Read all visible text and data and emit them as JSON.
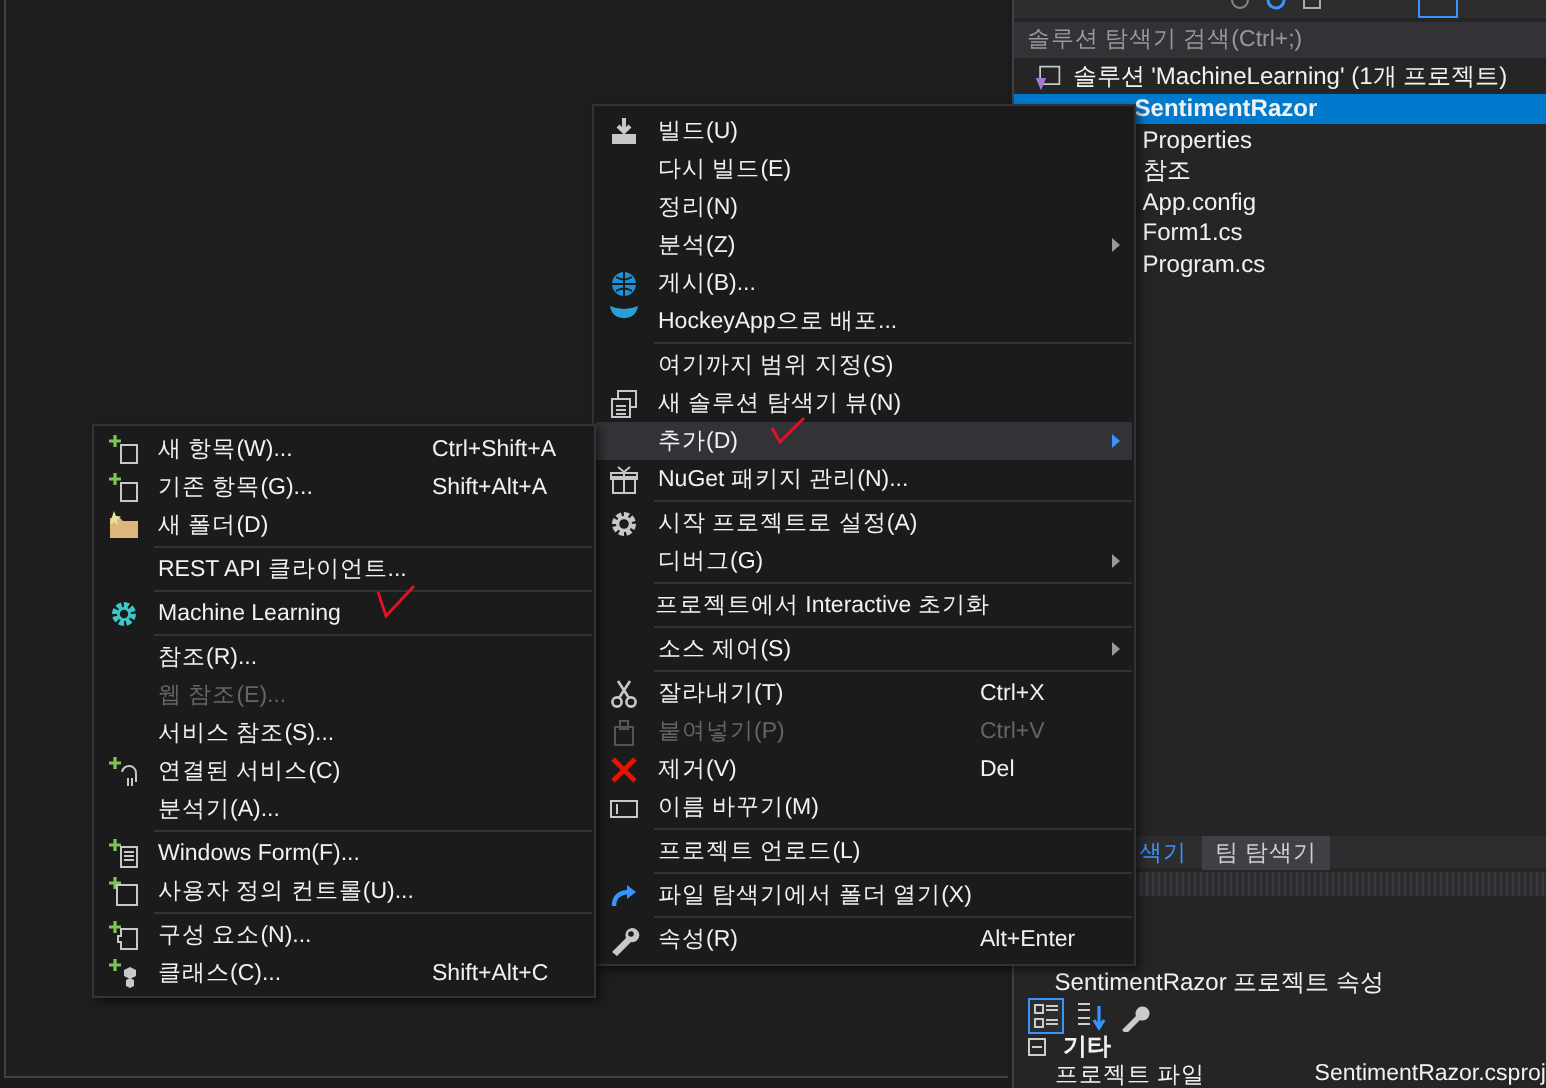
{
  "solution_explorer": {
    "search": {
      "placeholder": "솔루션 탐색기 검색(Ctrl+;)"
    },
    "tree": [
      {
        "label": "솔루션 'MachineLearning' (1개 프로젝트)",
        "selected": false,
        "startup": false,
        "children": [
          {
            "label": "SentimentRazor",
            "selected": true,
            "startup": true,
            "children": [
              {
                "label": "Properties",
                "selected": false,
                "startup": false
              },
              {
                "label": "참조",
                "selected": false,
                "startup": false
              },
              {
                "label": "App.config",
                "selected": false,
                "startup": false
              },
              {
                "label": "Form1.cs",
                "selected": false,
                "startup": false
              },
              {
                "label": "Program.cs",
                "selected": false,
                "startup": false
              }
            ]
          }
        ]
      }
    ]
  },
  "tabs": [
    {
      "label": "색기",
      "selected": true
    },
    {
      "label": "팀 탐색기",
      "selected": false
    }
  ],
  "properties": {
    "title": "SentimentRazor 프로젝트 속성",
    "category": {
      "label": "기타",
      "expanded": true
    },
    "rows": [
      {
        "name": "프로젝트 파일",
        "value": "SentimentRazor.csproj"
      }
    ]
  },
  "context_menu": {
    "items": [
      {
        "kind": "item",
        "label": "빌드(U)",
        "selected": false,
        "disabled": false,
        "submenu": false
      },
      {
        "kind": "item",
        "label": "다시 빌드(E)",
        "selected": false,
        "disabled": false,
        "submenu": false
      },
      {
        "kind": "item",
        "label": "정리(N)",
        "selected": false,
        "disabled": false,
        "submenu": false
      },
      {
        "kind": "item",
        "label": "분석(Z)",
        "selected": false,
        "disabled": false,
        "submenu": true
      },
      {
        "kind": "item",
        "label": "게시(B)...",
        "selected": false,
        "disabled": false,
        "submenu": false
      },
      {
        "kind": "item",
        "label": "HockeyApp으로 배포...",
        "selected": false,
        "disabled": false,
        "submenu": false
      },
      {
        "kind": "separator"
      },
      {
        "kind": "item",
        "label": "여기까지 범위 지정(S)",
        "selected": false,
        "disabled": false,
        "submenu": false
      },
      {
        "kind": "item",
        "label": "새 솔루션 탐색기 뷰(N)",
        "selected": false,
        "disabled": false,
        "submenu": false
      },
      {
        "kind": "item",
        "label": "추가(D)",
        "selected": true,
        "disabled": false,
        "submenu": true
      },
      {
        "kind": "item",
        "label": "NuGet 패키지 관리(N)...",
        "selected": false,
        "disabled": false,
        "submenu": false
      },
      {
        "kind": "separator"
      },
      {
        "kind": "item",
        "label": "시작 프로젝트로 설정(A)",
        "selected": false,
        "disabled": false,
        "submenu": false
      },
      {
        "kind": "item",
        "label": "디버그(G)",
        "selected": false,
        "disabled": false,
        "submenu": true
      },
      {
        "kind": "separator"
      },
      {
        "kind": "item",
        "label": "프로젝트에서 Interactive 초기화",
        "selected": false,
        "disabled": false,
        "submenu": false
      },
      {
        "kind": "separator"
      },
      {
        "kind": "item",
        "label": "소스 제어(S)",
        "selected": false,
        "disabled": false,
        "submenu": true
      },
      {
        "kind": "separator"
      },
      {
        "kind": "item",
        "label": "잘라내기(T)",
        "shortcut": "Ctrl+X",
        "selected": false,
        "disabled": false,
        "submenu": false
      },
      {
        "kind": "item",
        "label": "붙여넣기(P)",
        "shortcut": "Ctrl+V",
        "selected": false,
        "disabled": true,
        "submenu": false
      },
      {
        "kind": "item",
        "label": "제거(V)",
        "shortcut": "Del",
        "selected": false,
        "disabled": false,
        "submenu": false
      },
      {
        "kind": "item",
        "label": "이름 바꾸기(M)",
        "selected": false,
        "disabled": false,
        "submenu": false
      },
      {
        "kind": "separator"
      },
      {
        "kind": "item",
        "label": "프로젝트 언로드(L)",
        "selected": false,
        "disabled": false,
        "submenu": false
      },
      {
        "kind": "separator"
      },
      {
        "kind": "item",
        "label": "파일 탐색기에서 폴더 열기(X)",
        "selected": false,
        "disabled": false,
        "submenu": false
      },
      {
        "kind": "separator"
      },
      {
        "kind": "item",
        "label": "속성(R)",
        "shortcut": "Alt+Enter",
        "selected": false,
        "disabled": false,
        "submenu": false
      }
    ]
  },
  "add_submenu": {
    "items": [
      {
        "kind": "item",
        "label": "새 항목(W)...",
        "shortcut": "Ctrl+Shift+A",
        "disabled": false
      },
      {
        "kind": "item",
        "label": "기존 항목(G)...",
        "shortcut": "Shift+Alt+A",
        "disabled": false
      },
      {
        "kind": "item",
        "label": "새 폴더(D)",
        "disabled": false
      },
      {
        "kind": "separator"
      },
      {
        "kind": "item",
        "label": "REST API 클라이언트...",
        "disabled": false
      },
      {
        "kind": "separator"
      },
      {
        "kind": "item",
        "label": "Machine Learning",
        "disabled": false
      },
      {
        "kind": "separator"
      },
      {
        "kind": "item",
        "label": "참조(R)...",
        "disabled": false
      },
      {
        "kind": "item",
        "label": "웹 참조(E)...",
        "disabled": true
      },
      {
        "kind": "item",
        "label": "서비스 참조(S)...",
        "disabled": false
      },
      {
        "kind": "item",
        "label": "연결된 서비스(C)",
        "disabled": false
      },
      {
        "kind": "item",
        "label": "분석기(A)...",
        "disabled": false
      },
      {
        "kind": "separator"
      },
      {
        "kind": "item",
        "label": "Windows Form(F)...",
        "disabled": false
      },
      {
        "kind": "item",
        "label": "사용자 정의 컨트롤(U)...",
        "disabled": false
      },
      {
        "kind": "separator"
      },
      {
        "kind": "item",
        "label": "구성 요소(N)...",
        "disabled": false
      },
      {
        "kind": "item",
        "label": "클래스(C)...",
        "shortcut": "Shift+Alt+C",
        "disabled": false
      }
    ]
  }
}
